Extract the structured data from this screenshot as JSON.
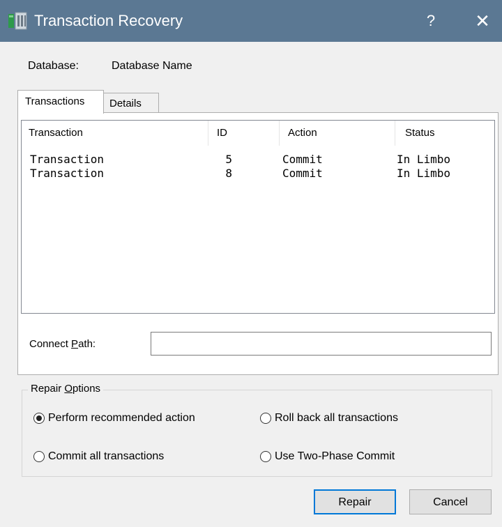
{
  "window": {
    "title": "Transaction Recovery",
    "help_label": "?",
    "close_label": "✕",
    "titlebar_color": "#5b7893"
  },
  "database": {
    "label": "Database:",
    "value": "Database Name"
  },
  "tabs": [
    {
      "label": "Transactions",
      "selected": true
    },
    {
      "label": "Details",
      "selected": false
    }
  ],
  "list": {
    "columns": [
      "Transaction",
      "ID",
      "Action",
      "Status"
    ],
    "rows": [
      {
        "transaction": "Transaction",
        "id": "5",
        "action": "Commit",
        "status": "In Limbo"
      },
      {
        "transaction": "Transaction",
        "id": "8",
        "action": "Commit",
        "status": "In Limbo"
      }
    ]
  },
  "connect_path": {
    "label_prefix": "Connect ",
    "label_mnemonic": "P",
    "label_suffix": "ath:",
    "value": ""
  },
  "repair_options": {
    "title_prefix": "Repair ",
    "title_mnemonic": "O",
    "title_suffix": "ptions",
    "options": [
      {
        "label": "Perform recommended action",
        "checked": true
      },
      {
        "label": "Roll back all transactions",
        "checked": false
      },
      {
        "label": "Commit all transactions",
        "checked": false
      },
      {
        "label": "Use Two-Phase Commit",
        "checked": false
      }
    ]
  },
  "buttons": {
    "repair": "Repair",
    "cancel": "Cancel"
  },
  "colors": {
    "default_button_border": "#0078d7",
    "dialog_background": "#f0f0f0"
  }
}
